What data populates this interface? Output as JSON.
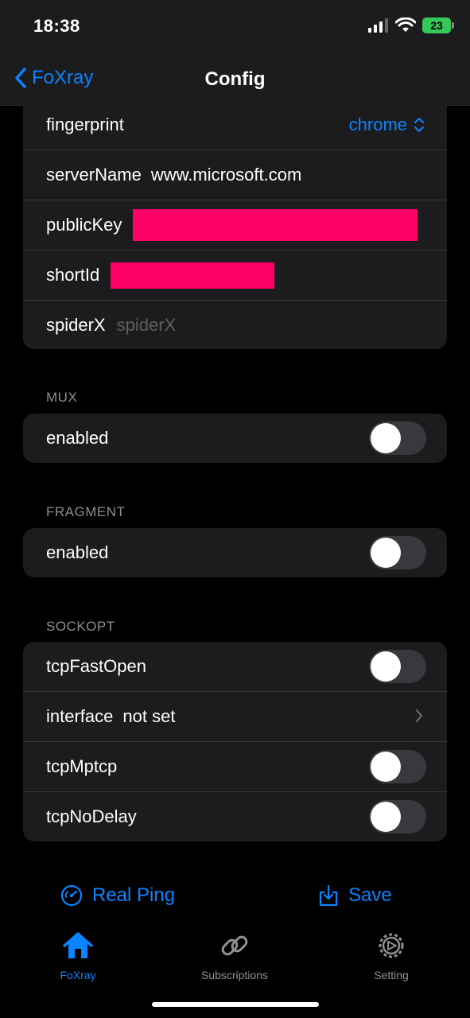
{
  "status": {
    "time": "18:38",
    "battery": "23"
  },
  "nav": {
    "back_label": "FoXray",
    "title": "Config"
  },
  "reality": {
    "fingerprint_label": "fingerprint",
    "fingerprint_value": "chrome",
    "servername_label": "serverName",
    "servername_value": "www.microsoft.com",
    "publickey_label": "publicKey",
    "shortid_label": "shortId",
    "spiderx_label": "spiderX",
    "spiderx_placeholder": "spiderX"
  },
  "mux": {
    "title": "MUX",
    "enabled_label": "enabled",
    "enabled": false
  },
  "fragment": {
    "title": "FRAGMENT",
    "enabled_label": "enabled",
    "enabled": false
  },
  "sockopt": {
    "title": "SOCKOPT",
    "tcpfastopen_label": "tcpFastOpen",
    "tcpfastopen": false,
    "interface_label": "interface",
    "interface_value": "not set",
    "tcpmptcp_label": "tcpMptcp",
    "tcpmptcp": false,
    "tcpnodelay_label": "tcpNoDelay",
    "tcpnodelay": false
  },
  "actions": {
    "ping_label": "Real Ping",
    "save_label": "Save"
  },
  "tabs": [
    {
      "label": "FoXray",
      "icon": "house-icon",
      "active": true
    },
    {
      "label": "Subscriptions",
      "icon": "link-icon",
      "active": false
    },
    {
      "label": "Setting",
      "icon": "gear-icon",
      "active": false
    }
  ],
  "colors": {
    "accent": "#0a84ff",
    "redaction": "#ff0066",
    "cell": "#1c1c1e"
  }
}
